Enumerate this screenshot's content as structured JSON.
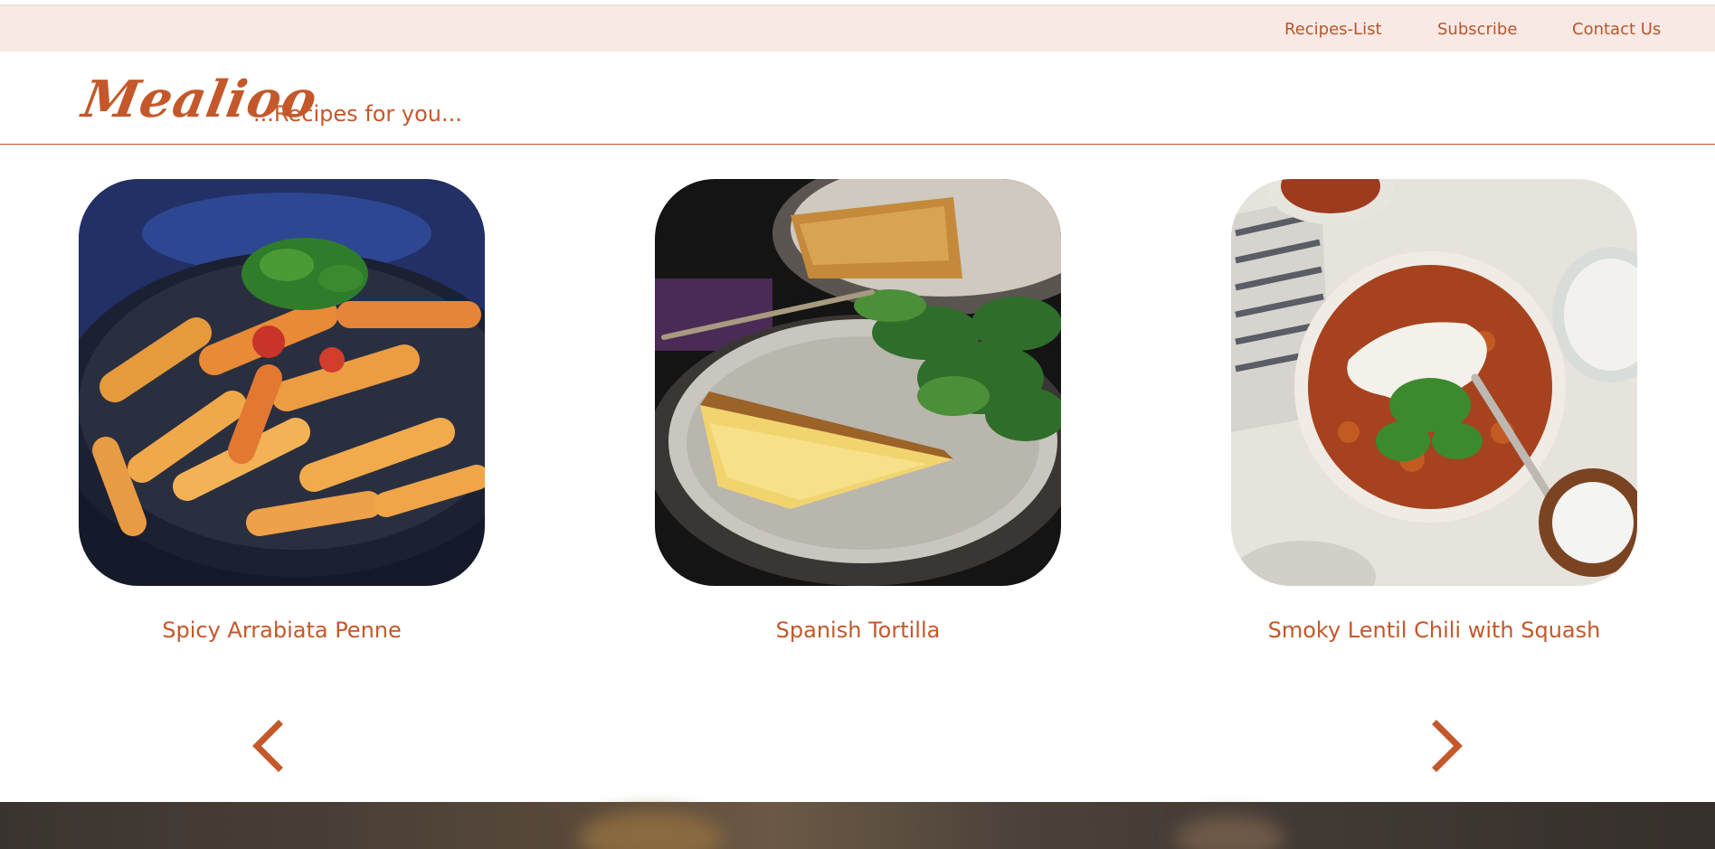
{
  "nav": {
    "items": [
      {
        "label": "Recipes-List"
      },
      {
        "label": "Subscribe"
      },
      {
        "label": "Contact Us"
      }
    ]
  },
  "brand": {
    "logo": "Mealioo",
    "tagline": "...Recipes for you..."
  },
  "carousel": {
    "cards": [
      {
        "title": "Spicy Arrabiata Penne"
      },
      {
        "title": "Spanish Tortilla"
      },
      {
        "title": "Smoky Lentil Chili with Squash"
      }
    ],
    "prev_icon": "chevron-left-icon",
    "next_icon": "chevron-right-icon"
  },
  "colors": {
    "accent": "#c4582a",
    "topbar_bg": "#f8e9e5"
  }
}
